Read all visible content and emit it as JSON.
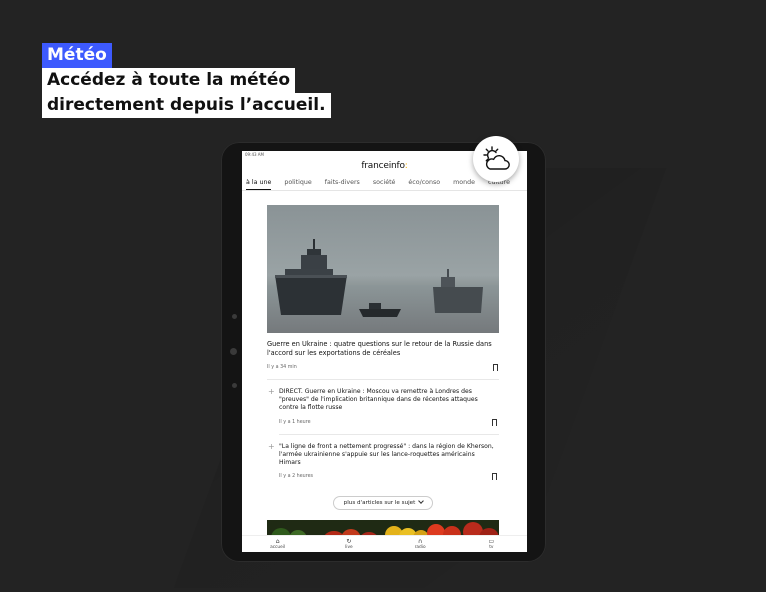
{
  "caption": {
    "tag": "Météo",
    "line1": "Accédez à toute la météo",
    "line2": "directement depuis l’accueil."
  },
  "app": {
    "status_time": "09:43 AM",
    "brand": "franceinfo",
    "brand_dot": ":",
    "tabs": [
      {
        "label": "à la une",
        "active": true
      },
      {
        "label": "politique",
        "active": false
      },
      {
        "label": "faits-divers",
        "active": false
      },
      {
        "label": "société",
        "active": false
      },
      {
        "label": "éco/conso",
        "active": false
      },
      {
        "label": "monde",
        "active": false
      },
      {
        "label": "culture",
        "active": false
      }
    ],
    "lead": {
      "title": "Guerre en Ukraine : quatre questions sur le retour de la Russie dans l'accord sur les exportations de céréales",
      "time": "Il y a 34 min"
    },
    "related": [
      {
        "title": "DIRECT. Guerre en Ukraine : Moscou va remettre à Londres des \"preuves\" de l'implication britannique dans de récentes attaques contre la flotte russe",
        "time": "Il y a 1 heure"
      },
      {
        "title": "\"La ligne de front a nettement progressé\" : dans la région de Kherson, l'armée ukrainienne s'appuie sur les lance-roquettes américains Himars",
        "time": "Il y a 2 heures"
      }
    ],
    "more_button": "plus d'articles sur le sujet",
    "bottom_nav": [
      {
        "label": "accueil",
        "icon": "home-icon"
      },
      {
        "label": "live",
        "icon": "live-icon"
      },
      {
        "label": "radio",
        "icon": "headphones-icon"
      },
      {
        "label": "tv",
        "icon": "tv-icon"
      }
    ],
    "weather_icon": "sun-cloud-icon"
  },
  "colors": {
    "background": "#232323",
    "tag_bg": "#3d5afe",
    "brand_accent": "#f5b400"
  }
}
